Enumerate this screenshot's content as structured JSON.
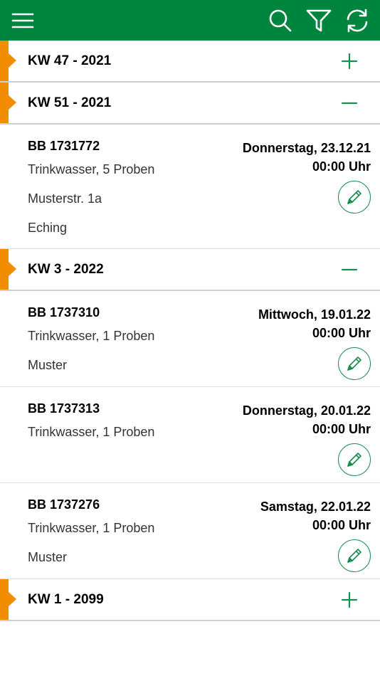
{
  "weeks": [
    {
      "title": "KW 47 - 2021",
      "toggle": "plus"
    },
    {
      "title": "KW 51 - 2021",
      "toggle": "minus",
      "entries": [
        {
          "id": "BB 1731772",
          "weekday_date": "Donnerstag, 23.12.21",
          "time": "00:00 Uhr",
          "lines": [
            "Trinkwasser, 5 Proben",
            "Musterstr. 1a",
            "Eching"
          ]
        }
      ]
    },
    {
      "title": "KW 3 - 2022",
      "toggle": "minus",
      "entries": [
        {
          "id": "BB 1737310",
          "weekday_date": "Mittwoch, 19.01.22",
          "time": "00:00 Uhr",
          "lines": [
            "Trinkwasser, 1 Proben",
            "Muster"
          ]
        },
        {
          "id": "BB 1737313",
          "weekday_date": "Donnerstag, 20.01.22",
          "time": "00:00 Uhr",
          "lines": [
            "Trinkwasser, 1 Proben"
          ]
        },
        {
          "id": "BB 1737276",
          "weekday_date": "Samstag, 22.01.22",
          "time": "00:00 Uhr",
          "lines": [
            "Trinkwasser, 1 Proben",
            "Muster"
          ]
        }
      ]
    },
    {
      "title": "KW 1 - 2099",
      "toggle": "plus"
    }
  ],
  "colors": {
    "header": "#00853f",
    "marker": "#f28c00",
    "accent": "#1a8c4e"
  },
  "icons": {
    "menu": "hamburger-icon",
    "search": "search-icon",
    "filter": "filter-icon",
    "refresh": "refresh-icon",
    "edit": "pencil-icon"
  }
}
